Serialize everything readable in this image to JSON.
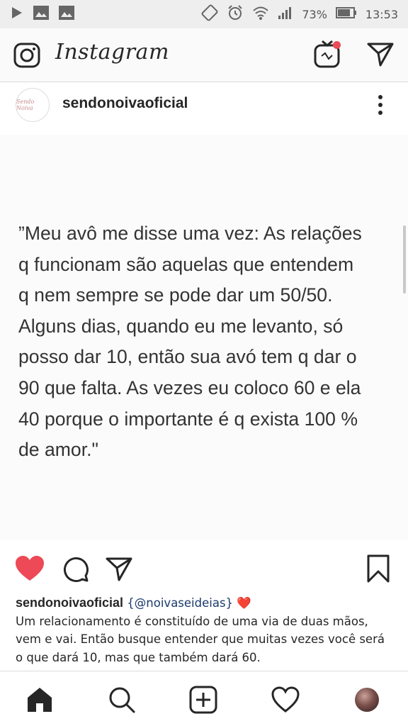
{
  "status_bar": {
    "battery": "73%",
    "time": "13:53",
    "icons": [
      "play-store-icon",
      "gallery-icon",
      "gallery-icon",
      "nfc-icon",
      "alarm-icon",
      "wifi-icon",
      "signal-icon",
      "battery-icon"
    ]
  },
  "header": {
    "app_title": "Instagram",
    "icons": [
      "camera-icon",
      "igtv-icon",
      "direct-message-icon"
    ],
    "igtv_notification_color": "#ed4956"
  },
  "post": {
    "username": "sendonoivaoficial",
    "avatar_text": "Sendo Noiva",
    "quote": "”Meu avô me disse uma vez: As relações\nq funcionam são aquelas que entendem\nq nem sempre se pode dar um 50/50.\nAlguns dias, quando eu me levanto, só\nposso dar 10, então sua avó tem q dar o\n90 que falta. As vezes eu coloco 60 e ela\n40 porque o importante é q exista 100 %\nde amor.\"",
    "liked": true,
    "like_color": "#ed4956",
    "caption": {
      "username": "sendonoivaoficial",
      "mention": "{@noivaseideias}",
      "emoji": "❤️",
      "text": "Um relacionamento é constituído de uma via de duas mãos, vem e vai. Então busque entender que muitas vezes você será o que dará 10, mas que também dará 60."
    }
  },
  "bottom_nav": [
    "home-icon",
    "search-icon",
    "new-post-icon",
    "activity-icon",
    "profile-avatar"
  ]
}
